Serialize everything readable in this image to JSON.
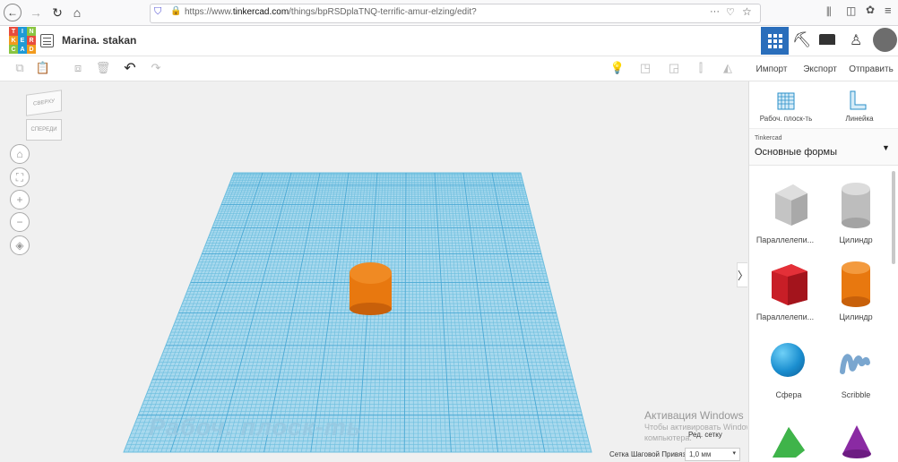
{
  "browser": {
    "url_prefix": "https://www.",
    "url_domain": "tinkercad.com",
    "url_path": "/things/bpRSDplaTNQ-terrific-amur-elzing/edit?",
    "more_glyph": "···"
  },
  "header": {
    "logo_letters": [
      "T",
      "I",
      "N",
      "K",
      "E",
      "R",
      "C",
      "A",
      "D"
    ],
    "project_title": "Marina. stakan"
  },
  "toolbar": {
    "import_label": "Импорт",
    "export_label": "Экспорт",
    "send_label": "Отправить"
  },
  "viewcube": {
    "top_label": "СВЕРХУ",
    "front_label": "СПЕРЕДИ"
  },
  "workplane": {
    "label": "Рабоч. плоск-ть"
  },
  "panel": {
    "workplane_tool": "Рабоч. плоск-ть",
    "ruler_tool": "Линейка",
    "library_source": "Tinkercad",
    "library_name": "Основные формы",
    "shapes": [
      {
        "label": "Параллелепи...",
        "color": "#b7b7b7"
      },
      {
        "label": "Цилиндр",
        "color": "#b7b7b7"
      },
      {
        "label": "Параллелепи...",
        "color": "#d01f2a"
      },
      {
        "label": "Цилиндр",
        "color": "#e8780f"
      },
      {
        "label": "Сфера",
        "color": "#1b8fd0"
      },
      {
        "label": "Scribble",
        "color": "#7aa6cf"
      }
    ]
  },
  "status": {
    "edit_grid": "Ред. сетку",
    "snap_label": "Сетка Шаговой Привязки",
    "snap_value": "1,0 мм"
  },
  "watermark": {
    "title": "Активация Windows",
    "line1": "Чтобы активировать Windows, перейдите к параметрам",
    "line2": "компьютера."
  },
  "colors": {
    "accent": "#2a6ebb",
    "grid_fill": "#a9d9ee",
    "grid_line": "#6cbede",
    "cylinder": "#e8780f"
  }
}
